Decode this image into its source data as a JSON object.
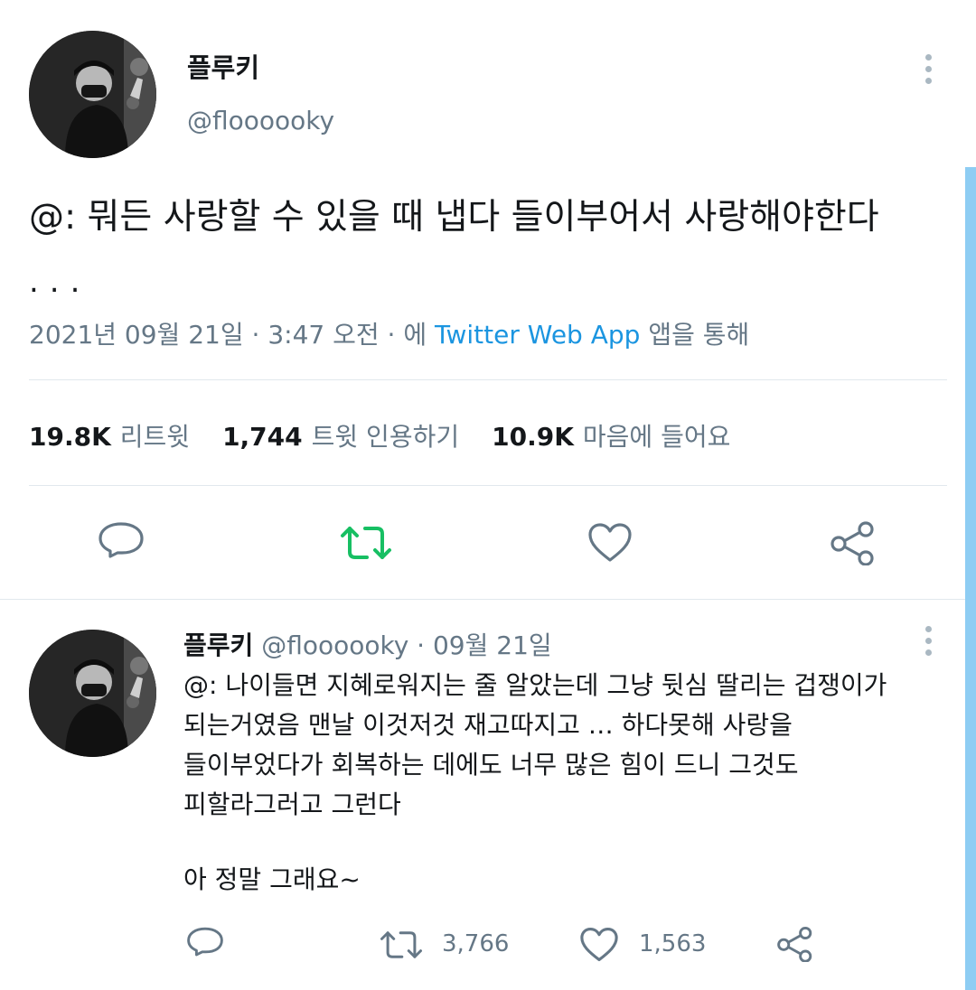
{
  "main_tweet": {
    "display_name": "플루키",
    "handle": "@floooooky",
    "text": "@: 뭐든 사랑할 수 있을 때 냅다 들이부어서 사랑해야한다",
    "ellipsis": "...",
    "date": "2021년 09월 21일",
    "time": "3:47 오전",
    "via_prefix": "에",
    "source": "Twitter Web App",
    "via_suffix": "앱을 통해",
    "stats": {
      "retweets": "19.8K",
      "retweets_label": "리트윗",
      "quotes": "1,744",
      "quotes_label": "트윗 인용하기",
      "likes": "10.9K",
      "likes_label": "마음에 들어요"
    },
    "actions": {
      "reply_icon": "reply-icon",
      "retweet_icon": "retweet-icon",
      "like_icon": "heart-icon",
      "share_icon": "share-icon"
    }
  },
  "reply": {
    "display_name": "플루키",
    "handle": "@floooooky",
    "separator": "·",
    "date": "09월 21일",
    "lines": [
      "@: 나이들면 지혜로워지는 줄 알았는데 그냥 뒷심 딸리는 겁쟁이가",
      "되는거였음 맨날 이것저것 재고따지고 … 하다못해 사랑을",
      "들이부었다가 회복하는 데에도 너무 많은 힘이 드니 그것도",
      "피할라그러고 그런다"
    ],
    "closing": "아 정말 그래요~",
    "retweet_count": "3,766",
    "like_count": "1,563"
  },
  "colors": {
    "text": "#14171a",
    "secondary": "#657786",
    "link": "#1b95e0",
    "retweet_green": "#17bf63",
    "divider": "#e1e8ed",
    "scrollbar": "#8ecdf3"
  }
}
